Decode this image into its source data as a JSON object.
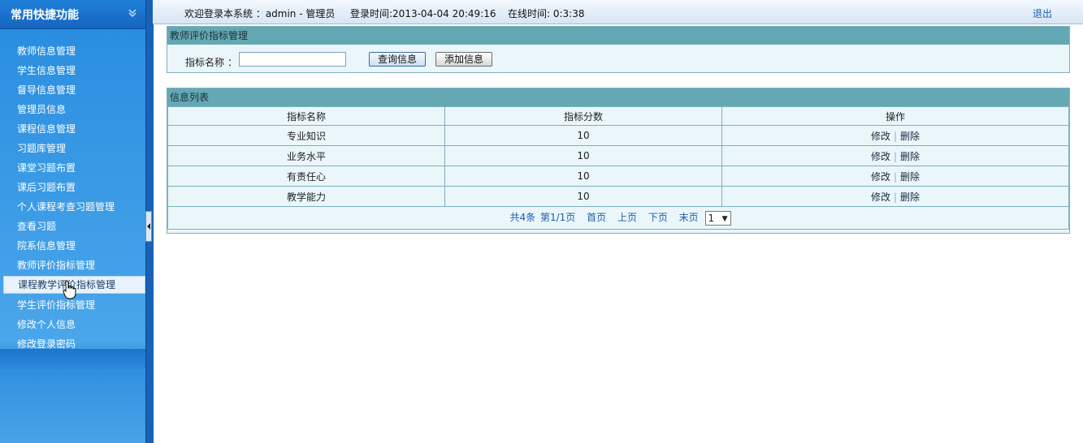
{
  "sidebar": {
    "title": "常用快捷功能",
    "items": [
      {
        "label": "教师信息管理"
      },
      {
        "label": "学生信息管理"
      },
      {
        "label": "督导信息管理"
      },
      {
        "label": "管理员信息"
      },
      {
        "label": "课程信息管理"
      },
      {
        "label": "习题库管理"
      },
      {
        "label": "课堂习题布置"
      },
      {
        "label": "课后习题布置"
      },
      {
        "label": "个人课程考查习题管理"
      },
      {
        "label": "查看习题"
      },
      {
        "label": "院系信息管理"
      },
      {
        "label": "教师评价指标管理"
      },
      {
        "label": "课程教学评价指标管理",
        "active": true
      },
      {
        "label": "学生评价指标管理"
      },
      {
        "label": "修改个人信息"
      },
      {
        "label": "修改登录密码"
      }
    ]
  },
  "topbar": {
    "welcome": "欢迎登录本系统 ：admin - 管理员",
    "login_time": "登录时间:2013-04-04 20:49:16",
    "online_time": "在线时间: 0:3:38",
    "logout": "退出"
  },
  "search_panel": {
    "title": "教师评价指标管理",
    "field_label": "指标名称 ：",
    "field_value": "",
    "query_button": "查询信息",
    "add_button": "添加信息"
  },
  "list_panel": {
    "title": "信息列表",
    "columns": [
      "指标名称",
      "指标分数",
      "操作"
    ],
    "rows": [
      {
        "name": "专业知识",
        "score": "10",
        "edit": "修改",
        "delete": "删除"
      },
      {
        "name": "业务水平",
        "score": "10",
        "edit": "修改",
        "delete": "删除"
      },
      {
        "name": "有责任心",
        "score": "10",
        "edit": "修改",
        "delete": "删除"
      },
      {
        "name": "教学能力",
        "score": "10",
        "edit": "修改",
        "delete": "删除"
      }
    ],
    "pager": {
      "total": "共4条",
      "page_info": "第1/1页",
      "first": "首页",
      "prev": "上页",
      "next": "下页",
      "last": "末页",
      "selected_page": "1"
    }
  },
  "colors": {
    "sidebar_blue": "#2a8ee0",
    "panel_header": "#64a8b4",
    "panel_bg": "#eaf6fa",
    "link_blue": "#1c5fb0"
  }
}
